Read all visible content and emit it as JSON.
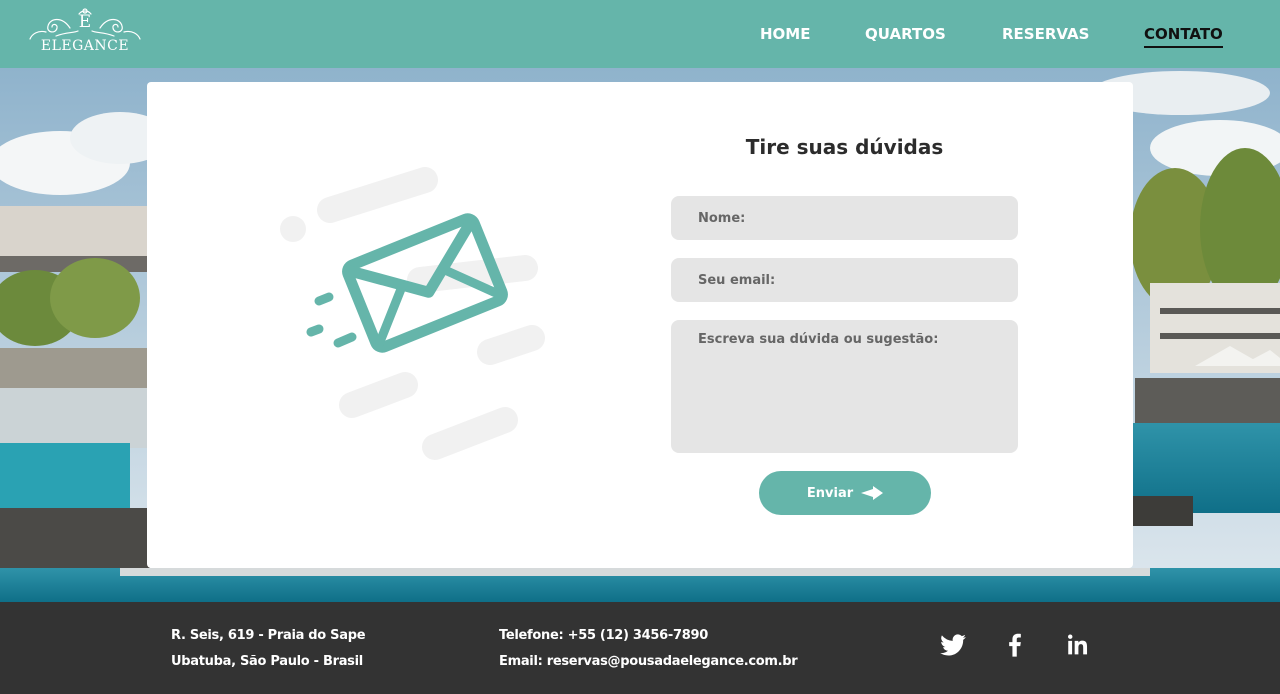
{
  "brand": {
    "monogram": "E",
    "name": "ELEGANCE"
  },
  "nav": {
    "items": [
      {
        "label": "HOME",
        "active": false
      },
      {
        "label": "QUARTOS",
        "active": false
      },
      {
        "label": "RESERVAS",
        "active": false
      },
      {
        "label": "CONTATO",
        "active": true
      }
    ]
  },
  "form": {
    "title": "Tire suas dúvidas",
    "name_placeholder": "Nome:",
    "email_placeholder": "Seu email:",
    "message_placeholder": "Escreva sua dúvida ou sugestão:",
    "submit_label": "Enviar"
  },
  "footer": {
    "address_line1": "R. Seis, 619 - Praia do Sape",
    "address_line2": "Ubatuba, São Paulo - Brasil",
    "phone": "Telefone: +55 (12) 3456-7890",
    "email": "Email: reservas@pousadaelegance.com.br",
    "social": [
      "twitter-icon",
      "facebook-icon",
      "linkedin-icon"
    ]
  },
  "colors": {
    "accent": "#65b5aa",
    "footer_bg": "#333333",
    "field_bg": "#e5e5e5",
    "active_nav": "#111111"
  }
}
